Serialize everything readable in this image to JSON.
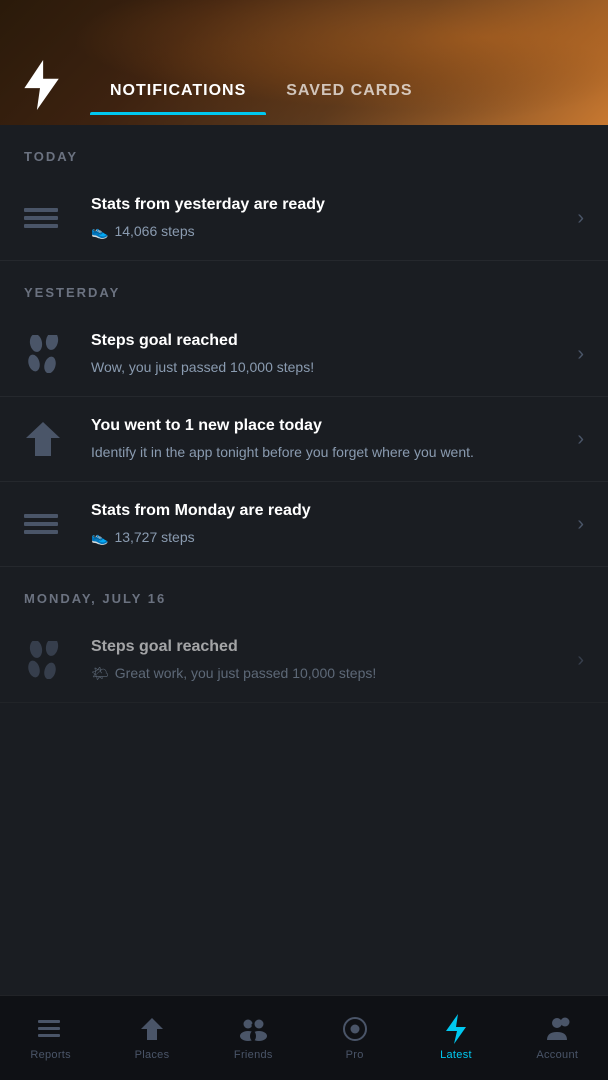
{
  "header": {
    "app_icon": "bolt",
    "tabs": [
      {
        "id": "notifications",
        "label": "NOTIFICATIONS",
        "active": true
      },
      {
        "id": "saved_cards",
        "label": "SAVED CARDS",
        "active": false
      }
    ]
  },
  "sections": [
    {
      "label": "TODAY",
      "items": [
        {
          "id": "today-1",
          "icon": "stats",
          "title": "Stats from yesterday are ready",
          "subtitle": "14,066 steps",
          "subtitle_has_icon": true
        }
      ]
    },
    {
      "label": "YESTERDAY",
      "items": [
        {
          "id": "yesterday-1",
          "icon": "footprints",
          "title": "Steps goal reached",
          "subtitle": "Wow, you just passed 10,000 steps!"
        },
        {
          "id": "yesterday-2",
          "icon": "location",
          "title": "You went to 1 new place today",
          "subtitle": "Identify it in the app tonight before you forget where you went."
        },
        {
          "id": "yesterday-3",
          "icon": "stats",
          "title": "Stats from Monday are ready",
          "subtitle": "13,727 steps",
          "subtitle_has_icon": true
        }
      ]
    },
    {
      "label": "MONDAY, JULY 16",
      "items": [
        {
          "id": "monday-1",
          "icon": "footprints",
          "title": "Steps goal reached",
          "subtitle": "Great work, you just passed 10,000 steps!",
          "partial": true
        }
      ]
    }
  ],
  "bottom_nav": [
    {
      "id": "reports",
      "label": "Reports",
      "icon": "reports",
      "active": false
    },
    {
      "id": "places",
      "label": "Places",
      "icon": "places",
      "active": false
    },
    {
      "id": "friends",
      "label": "Friends",
      "icon": "friends",
      "active": false
    },
    {
      "id": "pro",
      "label": "Pro",
      "icon": "pro",
      "active": false
    },
    {
      "id": "latest",
      "label": "Latest",
      "icon": "latest",
      "active": true
    },
    {
      "id": "account",
      "label": "Account",
      "icon": "account",
      "active": false
    }
  ]
}
